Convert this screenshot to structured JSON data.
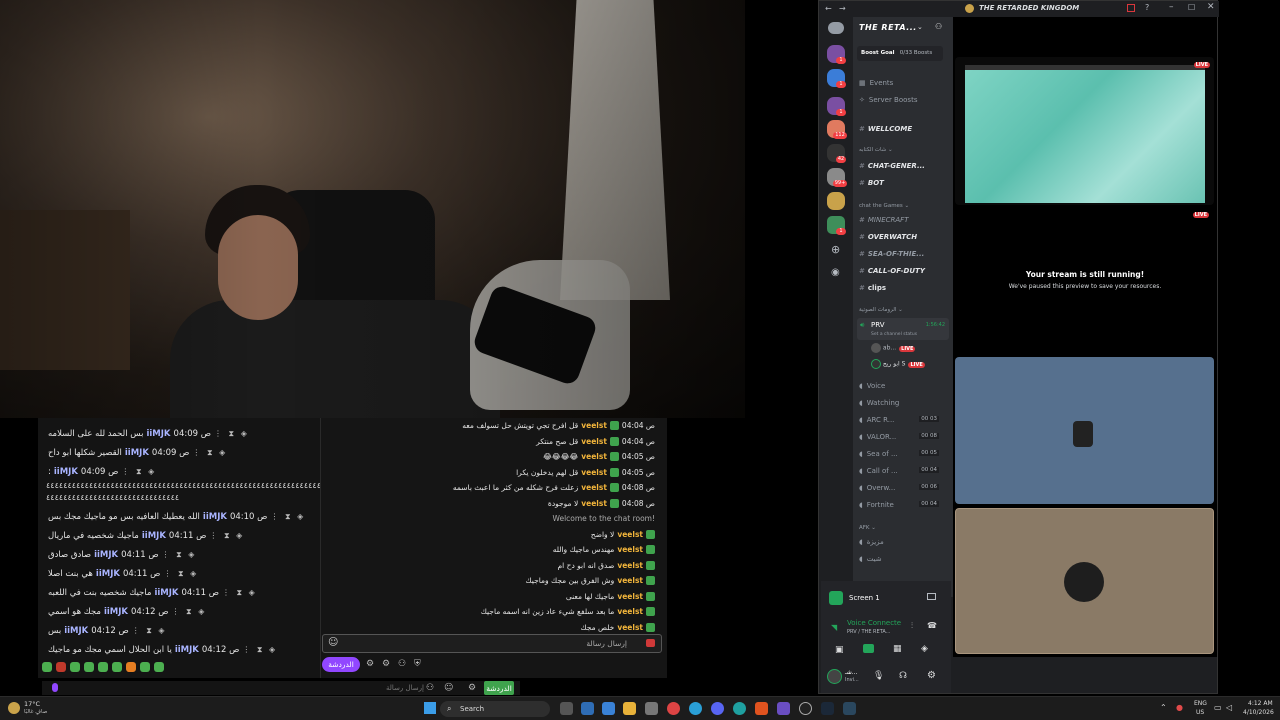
{
  "left_chat": [
    {
      "msg": "بس الحمد لله على السلامه",
      "user": "iiMJK",
      "time": "04:09 ص"
    },
    {
      "msg": "القصير شكلها ابو داح",
      "user": "iiMJK",
      "time": "04:09 ص"
    },
    {
      "msg": ":",
      "user": "iiMJK",
      "time": "04:09 ص"
    },
    {
      "msg": "الله يعطيك العافيه بس مو ماجيك مجك بس",
      "user": "iiMJK",
      "time": "04:10 ص"
    },
    {
      "msg": "ماجيك شخصيه في ماريال",
      "user": "iiMJK",
      "time": "04:11 ص"
    },
    {
      "msg": "صادق صادق",
      "user": "iiMJK",
      "time": "04:11 ص"
    },
    {
      "msg": "هي بنت اصلا",
      "user": "iiMJK",
      "time": "04:11 ص"
    },
    {
      "msg": "ماجيك شخصيه بنت في اللعبه",
      "user": "iiMJK",
      "time": "04:11 ص"
    },
    {
      "msg": "مجك هو اسمي",
      "user": "iiMJK",
      "time": "04:12 ص"
    },
    {
      "msg": "بس",
      "user": "iiMJK",
      "time": "04:12 ص"
    },
    {
      "msg": "يا ابن الحلال اسمي مجك مو ماجيك",
      "user": "iiMJK",
      "time": "04:12 ص"
    }
  ],
  "left_wide_line": "٤٤٤٤٤٤٤٤٤٤٤٤٤٤٤٤٤٤٤٤٤٤٤٤٤٤٤٤٤٤٤٤٤٤٤٤٤٤٤٤٤٤٤٤٤٤٤٤٤٤٤٤٤٤٤٤٤٤٤٤٤٤٤٤٤٤٤٤٤٤٤٤٤٤٤٤٤٤٤٤٤٤٤٤٤٤٤٤",
  "left_wide_line2": "٤٤٤٤٤٤٤٤٤٤٤٤٤٤٤٤٤٤٤٤٤٤٤٤٤٤٤٤٤٤٤",
  "right_chat": [
    {
      "time": "04:04 ص",
      "user": "veelst",
      "msg": "قل افرح تجي تويتش حل تسولف معه"
    },
    {
      "time": "04:04 ص",
      "user": "veelst",
      "msg": "قل صح منتكر"
    },
    {
      "time": "04:05 ص",
      "user": "veelst",
      "msg": "😂😂😂😂"
    },
    {
      "time": "04:05 ص",
      "user": "veelst",
      "msg": "قل لهم يدخلون يكرا"
    },
    {
      "time": "04:08 ص",
      "user": "veelst",
      "msg": "زعلت فرح شكله من كثر ما اعبث باسمه"
    },
    {
      "time": "04:08 ص",
      "user": "veelst",
      "msg": "لا موجودة"
    }
  ],
  "welcome_text": "Welcome to the chat room!",
  "right_chat2": [
    {
      "user": "veelst",
      "msg": "لا واضح"
    },
    {
      "user": "veelst",
      "msg": "مهندس ماجيك والله"
    },
    {
      "user": "veelst",
      "msg": "صدق انه ابو دح ام"
    },
    {
      "user": "veelst",
      "msg": "وش الفرق بين مجك وماجيك"
    },
    {
      "user": "veelst",
      "msg": "ماجيك لها معنى"
    },
    {
      "user": "veelst",
      "msg": "ما بعد سلفع شيء عاد زين انه اسمه ماجيك"
    },
    {
      "user": "veelst",
      "msg": "خلص مجك"
    }
  ],
  "chat_input": {
    "placeholder": "إرسال رسالة"
  },
  "chat_tools": {
    "chat_button": "الدردشة"
  },
  "left_bottom": {
    "placeholder": "إرسال رسالة",
    "chat_button": "الدردشة"
  },
  "discord": {
    "title": "THE RETARDED KINGDOM",
    "server_name": "THE RETA...",
    "boost_goal": "Boost Goal",
    "boost_count": "0/33 Boosts",
    "events": "Events",
    "server_boosts": "Server Boosts",
    "channels": [
      {
        "name": "WELLCOME",
        "kind": "text"
      },
      {
        "name": "شات الكتابه",
        "kind": "cat"
      },
      {
        "name": "CHAT-GENER...",
        "kind": "text"
      },
      {
        "name": "BOT",
        "kind": "text"
      },
      {
        "name": "chat the Games",
        "kind": "cat"
      },
      {
        "name": "MINECRAFT",
        "kind": "text"
      },
      {
        "name": "OVERWATCH",
        "kind": "text"
      },
      {
        "name": "SEA-OF-THIE...",
        "kind": "text"
      },
      {
        "name": "CALL-OF-DUTY",
        "kind": "text"
      },
      {
        "name": "clips",
        "kind": "text"
      },
      {
        "name": "الرومات الصوتية",
        "kind": "cat"
      }
    ],
    "prv": "PRV",
    "prv_timer": "1:56:42",
    "set_status": "Set a channel status",
    "member1": "ab...",
    "member2": "ابو ريح S",
    "live": "LIVE",
    "voice_channels": [
      {
        "name": "Voice",
        "count": ""
      },
      {
        "name": "Watching",
        "count": ""
      },
      {
        "name": "ARC R...",
        "count": "00 03"
      },
      {
        "name": "VALOR...",
        "count": "00 08"
      },
      {
        "name": "Sea of ...",
        "count": "00 05"
      },
      {
        "name": "Call of ...",
        "count": "00 04"
      },
      {
        "name": "Overw...",
        "count": "00 06"
      },
      {
        "name": "Fortnite",
        "count": "00 04"
      }
    ],
    "afk_cat": "AFK",
    "afk1": "مزيزة",
    "afk2": "شيت",
    "screen": "Screen 1",
    "voice_connected": "Voice Connecte",
    "voice_sub": "PRV / THE RETA...",
    "user_name": "شـ...",
    "user_sub": "Invi...",
    "stream_running": "Your stream is still running!",
    "stream_paused": "We've paused this preview to save your resources.",
    "server_badges": [
      "1",
      "1",
      "1",
      "112",
      "42",
      "99+",
      "1"
    ]
  },
  "taskbar": {
    "weather_temp": "17°C",
    "weather_desc": "صافٍ غالبًا",
    "search": "Search",
    "lang": "ENG",
    "region": "US",
    "time": "4:12 AM",
    "date": "4/10/2026"
  }
}
